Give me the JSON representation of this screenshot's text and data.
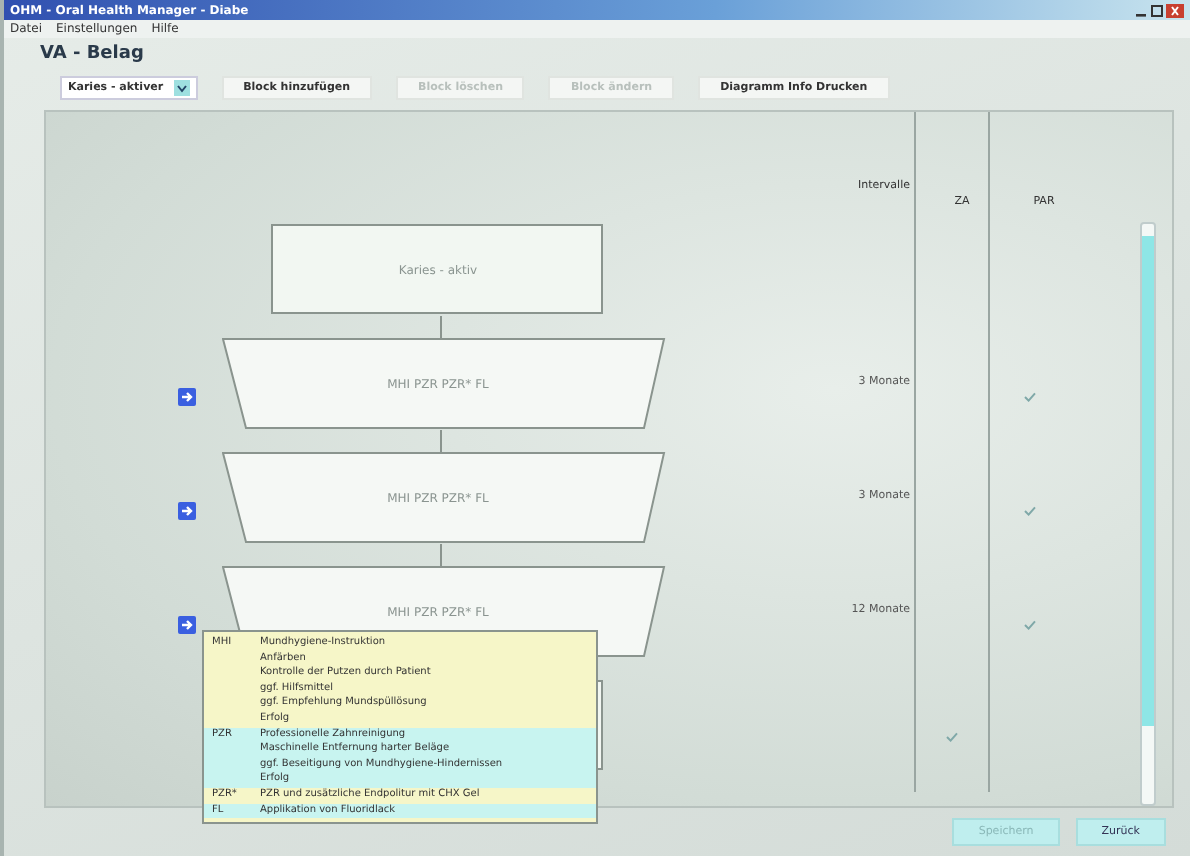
{
  "window": {
    "title": "OHM - Oral Health Manager - Diabe"
  },
  "menu": [
    {
      "label": "Datei"
    },
    {
      "label": "Einstellungen"
    },
    {
      "label": "Hilfe"
    }
  ],
  "page_title": "VA - Belag",
  "toolbar": {
    "dropdown": {
      "value": "Karies - aktiver"
    },
    "buttons": [
      {
        "label": "Block hinzufügen",
        "disabled": false
      },
      {
        "label": "Block löschen",
        "disabled": true
      },
      {
        "label": "Block ändern",
        "disabled": true
      },
      {
        "label": "Diagramm Info Drucken",
        "disabled": false
      }
    ]
  },
  "columns": [
    "Intervalle",
    "ZA",
    "PAR"
  ],
  "blocks": [
    {
      "kind": "start",
      "label": "Karies - aktiv"
    },
    {
      "kind": "step",
      "label": "MHI PZR PZR* FL",
      "interval": "3 Monate",
      "za": false,
      "par": true
    },
    {
      "kind": "step",
      "label": "MHI PZR PZR* FL",
      "interval": "3 Monate",
      "za": false,
      "par": true
    },
    {
      "kind": "step",
      "label": "MHI PZR PZR* FL",
      "interval": "12 Monate",
      "za": false,
      "par": true
    },
    {
      "kind": "end",
      "za": true,
      "par": false
    }
  ],
  "legend": [
    {
      "code": "MHI",
      "color": "#f6f6c8",
      "lines": [
        "Mundhygiene-Instruktion",
        "Anfärben",
        "Kontrolle der Putzen durch Patient",
        "ggf. Hilfsmittel",
        "ggf. Empfehlung Mundspüllösung",
        "Erfolg"
      ]
    },
    {
      "code": "PZR",
      "color": "#c8f4f0",
      "lines": [
        "Professionelle Zahnreinigung",
        "Maschinelle Entfernung harter Beläge",
        "ggf. Beseitigung von Mundhygiene-Hindernissen",
        "Erfolg"
      ]
    },
    {
      "code": "PZR*",
      "color": "#f6f6c8",
      "lines": [
        "PZR und zusätzliche Endpolitur mit CHX Gel"
      ]
    },
    {
      "code": "FL",
      "color": "#c8f4f0",
      "lines": [
        "Applikation von Fluoridlack"
      ]
    }
  ],
  "footer_buttons": [
    {
      "label": "Speichern",
      "disabled": true
    },
    {
      "label": "Zurück",
      "disabled": false
    }
  ]
}
